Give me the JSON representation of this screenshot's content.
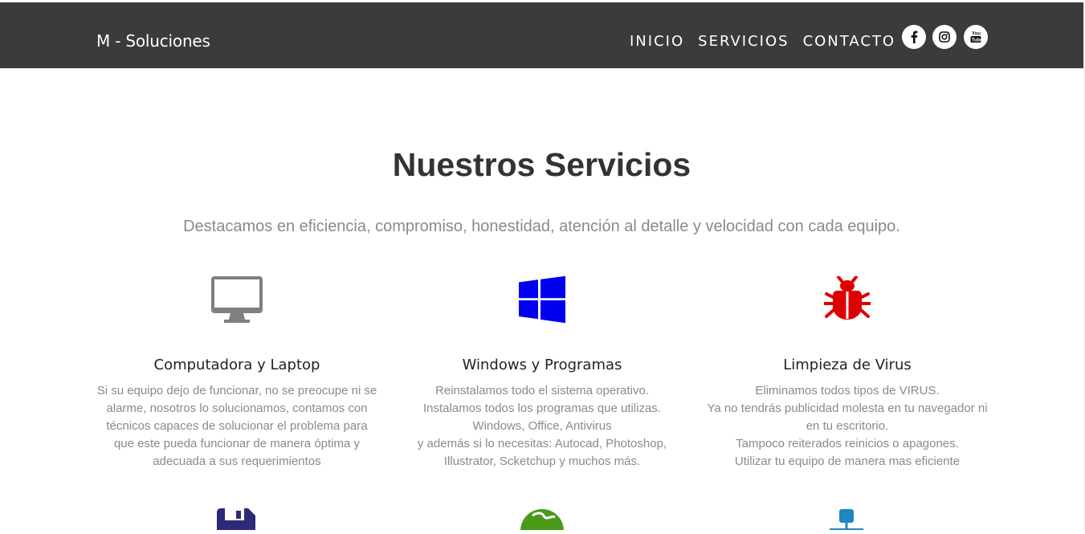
{
  "navbar": {
    "brand": "M - Soluciones",
    "links": [
      "INICIO",
      "SERVICIOS",
      "CONTACTO"
    ],
    "social": [
      "facebook-icon",
      "instagram-icon",
      "youtube-icon"
    ]
  },
  "services": {
    "title": "Nuestros Servicios",
    "subtitle": "Destacamos en eficiencia, compromiso, honestidad, atención al detalle y velocidad con cada equipo.",
    "cards": [
      {
        "icon": "desktop-icon",
        "color": "#808080",
        "title": "Computadora y Laptop",
        "lines": [
          "Si su equipo dejo de funcionar, no se preocupe ni se",
          "alarme, nosotros lo solucionamos, contamos con",
          "técnicos capaces de solucionar el problema para",
          "que este pueda funcionar de manera óptima y",
          "adecuada a sus requerimientos"
        ]
      },
      {
        "icon": "windows-icon",
        "color": "#0000ee",
        "title": "Windows y Programas",
        "lines": [
          "Reinstalamos todo el sistema operativo.",
          "Instalamos todos los programas que utilizas.",
          "Windows, Office, Antivirus",
          "y además si lo necesitas: Autocad, Photoshop,",
          "Illustrator, Scketchup y muchos más."
        ]
      },
      {
        "icon": "bug-icon",
        "color": "#dd0000",
        "title": "Limpieza de Virus",
        "lines": [
          "Eliminamos todos tipos de VIRUS.",
          "Ya no tendrás publicidad molesta en tu navegador ni",
          "en tu escritorio.",
          "Tampoco reiterados reinicios o apagones.",
          "Utilizar tu equipo de manera mas eficiente"
        ]
      }
    ],
    "next_row_icons": [
      {
        "icon": "floppy-disk-icon",
        "color": "#2d2a78"
      },
      {
        "icon": "globe-icon",
        "color": "#4a9a1a"
      },
      {
        "icon": "network-icon",
        "color": "#1f86c0"
      }
    ]
  }
}
